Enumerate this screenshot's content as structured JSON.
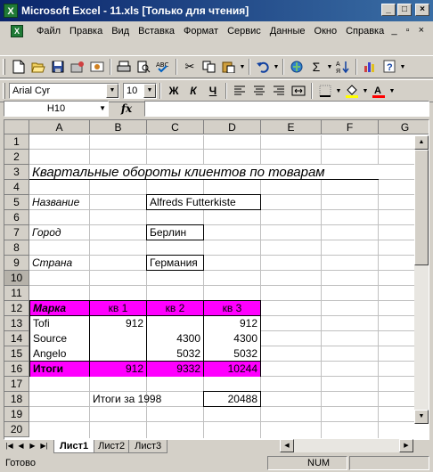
{
  "window": {
    "title": "Microsoft Excel - 11.xls  [Только для чтения]",
    "app_icon": "excel-icon",
    "controls": [
      "_",
      "□",
      "×"
    ]
  },
  "menu": {
    "items": [
      "Файл",
      "Правка",
      "Вид",
      "Вставка",
      "Формат",
      "Сервис",
      "Данные",
      "Окно",
      "Справка"
    ],
    "doc_controls": [
      "_",
      "▫",
      "×"
    ]
  },
  "toolbar_standard": {
    "icons": [
      "new-icon",
      "open-icon",
      "save-icon",
      "permission-icon",
      "email-icon",
      "print-icon",
      "print-preview-icon",
      "spelling-icon",
      "cut-icon",
      "copy-icon",
      "paste-icon",
      "undo-icon",
      "hyperlink-icon",
      "autosum-icon",
      "sort-icon",
      "chart-icon",
      "help-icon"
    ]
  },
  "toolbar_format": {
    "font": "Arial Cyr",
    "size": "10",
    "bold": "Ж",
    "italic": "К",
    "underline": "Ч"
  },
  "formula_bar": {
    "name_box": "H10",
    "fx": "fx",
    "value": ""
  },
  "columns": [
    "A",
    "B",
    "C",
    "D",
    "E",
    "F",
    "G"
  ],
  "rows": [
    "1",
    "2",
    "3",
    "4",
    "5",
    "6",
    "7",
    "8",
    "9",
    "10",
    "11",
    "12",
    "13",
    "14",
    "15",
    "16",
    "17",
    "18",
    "19",
    "20"
  ],
  "sheet": {
    "title": "Квартальные обороты клиентов по товарам",
    "name_label": "Название",
    "name_value": "Alfreds Futterkiste",
    "city_label": "Город",
    "city_value": "Берлин",
    "country_label": "Страна",
    "country_value": "Германия",
    "table_header": {
      "brand": "Марка",
      "q1": "кв 1",
      "q2": "кв 2",
      "q3": "кв 3"
    },
    "table_rows": [
      {
        "brand": "Tofi",
        "q1": "912",
        "q2": "",
        "q3": "912"
      },
      {
        "brand": "Source",
        "q1": "",
        "q2": "4300",
        "q3": "4300"
      },
      {
        "brand": "Angelo",
        "q1": "",
        "q2": "5032",
        "q3": "5032"
      }
    ],
    "totals": {
      "label": "Итоги",
      "q1": "912",
      "q2": "9332",
      "q3": "10244"
    },
    "year_total_label": "Итоги за 1998",
    "year_total_value": "20488",
    "highlight_color": "#ff00ff"
  },
  "tabs": [
    "Лист1",
    "Лист2",
    "Лист3"
  ],
  "status": {
    "ready": "Готово",
    "num": "NUM"
  }
}
